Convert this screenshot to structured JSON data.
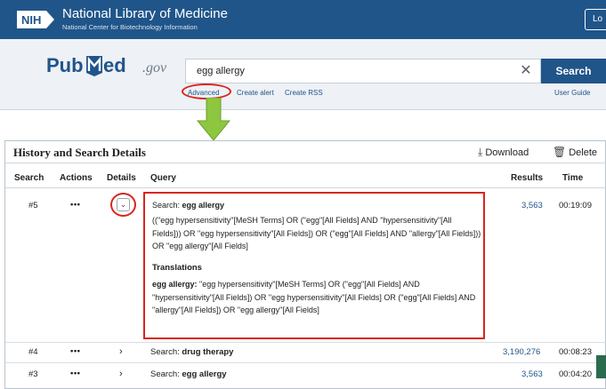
{
  "header": {
    "nih_logo": "NIH",
    "title": "National Library of Medicine",
    "subtitle": "National Center for Biotechnology Information",
    "login_label": "Lo",
    "bar_color": "#20558a"
  },
  "search": {
    "logo_pub": "Pub",
    "logo_med": "ed",
    "logo_gov": ".gov",
    "query_value": "egg allergy",
    "clear_icon": "close-icon",
    "button_label": "Search",
    "links": [
      "Advanced",
      "Create alert",
      "Create RSS"
    ],
    "user_guide": "User Guide"
  },
  "history": {
    "title": "History and Search Details",
    "download_label": "Download",
    "delete_label": "Delete",
    "columns": [
      "Search",
      "Actions",
      "Details",
      "Query",
      "Results",
      "Time"
    ],
    "rows": [
      {
        "number": "#5",
        "actions": "•••",
        "details_icon": "chevron-down-icon",
        "query_prefix": "Search:",
        "query_term": "egg allergy",
        "query_details": "((\"egg hypersensitivity\"[MeSH Terms] OR (\"egg\"[All Fields] AND \"hypersensitivity\"[All Fields])) OR \"egg hypersensitivity\"[All Fields]) OR (\"egg\"[All Fields] AND \"allergy\"[All Fields])) OR \"egg allergy\"[All Fields]",
        "translations_title": "Translations",
        "translation_term": "egg allergy:",
        "translation_text": "\"egg hypersensitivity\"[MeSH Terms] OR (\"egg\"[All Fields] AND \"hypersensitivity\"[All Fields]) OR \"egg hypersensitivity\"[All Fields] OR (\"egg\"[All Fields] AND \"allergy\"[All Fields]) OR \"egg allergy\"[All Fields]",
        "results": "3,563",
        "time": "00:19:09"
      },
      {
        "number": "#4",
        "actions": "•••",
        "details_icon": "chevron-right-icon",
        "query_prefix": "Search:",
        "query_term": "drug therapy",
        "results": "3,190,276",
        "time": "00:08:23"
      },
      {
        "number": "#3",
        "actions": "•••",
        "details_icon": "chevron-right-icon",
        "query_prefix": "Search:",
        "query_term": "egg allergy",
        "results": "3,563",
        "time": "00:04:20"
      }
    ]
  },
  "colors": {
    "accent": "#20558a",
    "highlight": "#d9261c",
    "arrow": "#8dc63f"
  }
}
